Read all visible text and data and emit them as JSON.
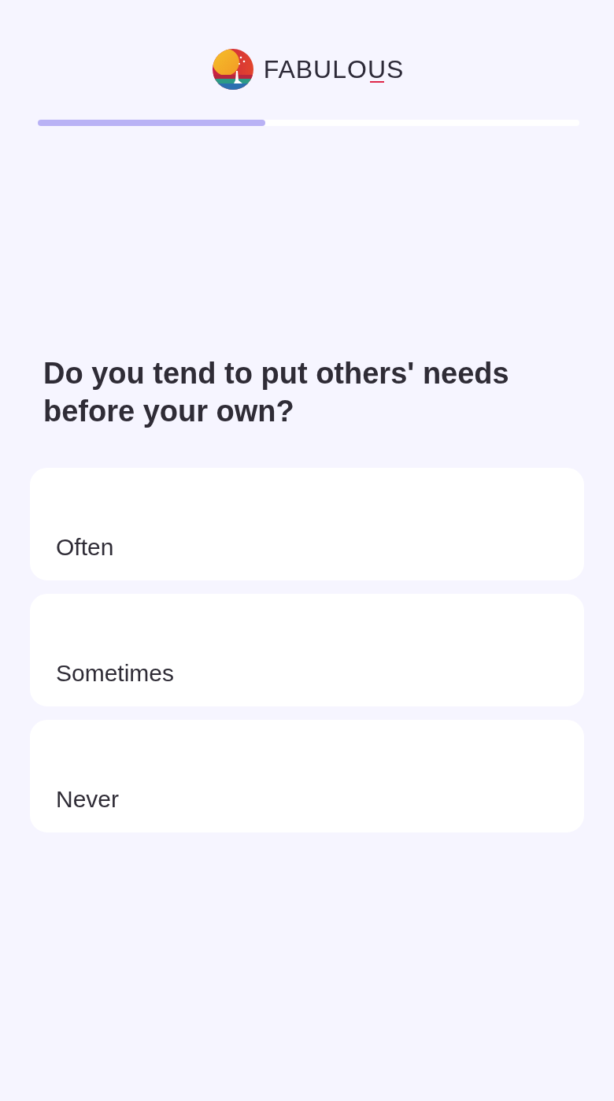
{
  "header": {
    "logo_text": "FABULOUS"
  },
  "progress": {
    "level": 0.42
  },
  "question": "Do you tend to put others' needs before your own?",
  "options": [
    {
      "label": "Often",
      "selected": false
    },
    {
      "label": "Sometimes",
      "selected": false
    },
    {
      "label": "Never",
      "selected": false
    }
  ]
}
